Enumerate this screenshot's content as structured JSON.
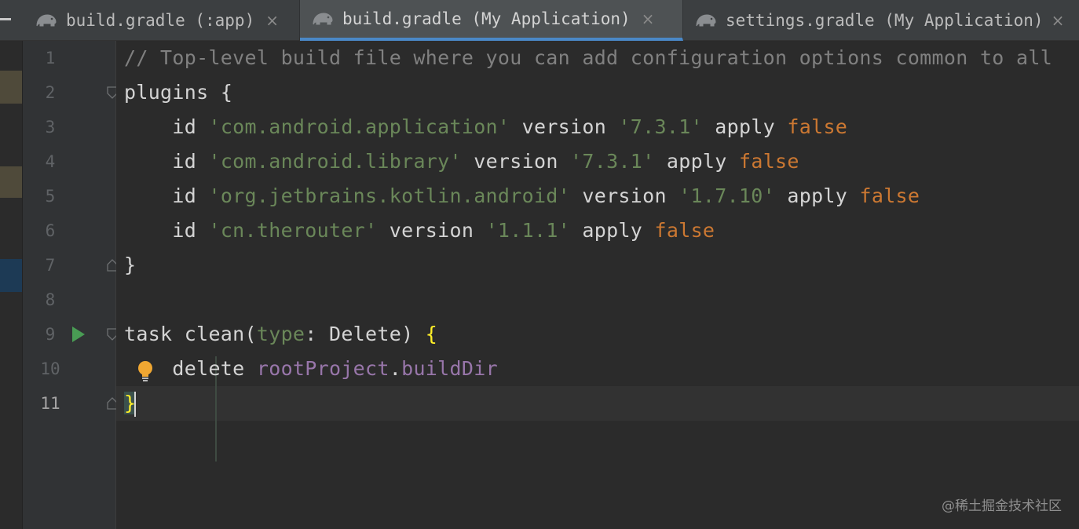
{
  "tabs": [
    {
      "label": "build.gradle (:app)",
      "icon": "gradle-elephant-icon",
      "active": false,
      "close": "×"
    },
    {
      "label": "build.gradle (My Application)",
      "icon": "gradle-elephant-icon",
      "active": true,
      "close": "×"
    },
    {
      "label": "settings.gradle (My Application)",
      "icon": "gradle-elephant-icon",
      "active": false,
      "close": "×"
    }
  ],
  "gutter": {
    "line_numbers": [
      "1",
      "2",
      "3",
      "4",
      "5",
      "6",
      "7",
      "8",
      "9",
      "10",
      "11"
    ],
    "current_line": "11"
  },
  "code": {
    "l1": "// Top-level build file where you can add configuration options common to all",
    "l2_kw": "plugins",
    "l2_brace": "{",
    "l3": [
      "id",
      "'com.android.application'",
      "version",
      "'7.3.1'",
      "apply",
      "false"
    ],
    "l4": [
      "id",
      "'com.android.library'",
      "version",
      "'7.3.1'",
      "apply",
      "false"
    ],
    "l5": [
      "id",
      "'org.jetbrains.kotlin.android'",
      "version",
      "'1.7.10'",
      "apply",
      "false"
    ],
    "l6": [
      "id",
      "'cn.therouter'",
      "version",
      "'1.1.1'",
      "apply",
      "false"
    ],
    "l7": "}",
    "l9": [
      "task clean(",
      "type",
      ": Delete) ",
      "{"
    ],
    "l10": [
      "delete ",
      "rootProject",
      ".",
      "buildDir"
    ],
    "l11": "}"
  },
  "colors": {
    "background": "#2b2b2b",
    "comment": "#808080",
    "keyword": "#cc7832",
    "string": "#6a8759",
    "property": "#9876aa",
    "brace_match": "#ffef28",
    "active_tab_underline": "#4a88c7"
  },
  "watermark": "@稀土掘金技术社区"
}
